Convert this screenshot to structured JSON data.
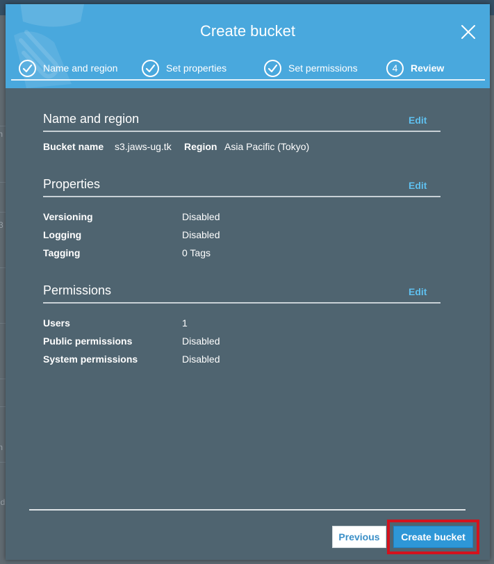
{
  "modal": {
    "title": "Create bucket",
    "close_icon": "close-icon"
  },
  "steps": [
    {
      "label": "Name and region",
      "state": "complete",
      "icon": "check-icon"
    },
    {
      "label": "Set properties",
      "state": "complete",
      "icon": "check-icon"
    },
    {
      "label": "Set permissions",
      "state": "complete",
      "icon": "check-icon"
    },
    {
      "label": "Review",
      "state": "active",
      "number": "4"
    }
  ],
  "sections": {
    "name_region": {
      "title": "Name and region",
      "edit_label": "Edit",
      "bucket_name_key": "Bucket name",
      "bucket_name_value": "s3.jaws-ug.tk",
      "region_key": "Region",
      "region_value": "Asia Pacific (Tokyo)"
    },
    "properties": {
      "title": "Properties",
      "edit_label": "Edit",
      "rows": [
        {
          "key": "Versioning",
          "value": "Disabled"
        },
        {
          "key": "Logging",
          "value": "Disabled"
        },
        {
          "key": "Tagging",
          "value": "0 Tags"
        }
      ]
    },
    "permissions": {
      "title": "Permissions",
      "edit_label": "Edit",
      "rows": [
        {
          "key": "Users",
          "value": "1"
        },
        {
          "key": "Public permissions",
          "value": "Disabled"
        },
        {
          "key": "System permissions",
          "value": "Disabled"
        }
      ]
    }
  },
  "footer": {
    "previous_label": "Previous",
    "create_label": "Create bucket"
  },
  "colors": {
    "header": "#49a8dd",
    "body": "#4f6470",
    "link": "#5fc0ef",
    "primary_button": "#2e97d7",
    "highlight": "#d4121d"
  },
  "background": {
    "glyphs": [
      "th",
      "3",
      "m",
      "ud"
    ]
  }
}
